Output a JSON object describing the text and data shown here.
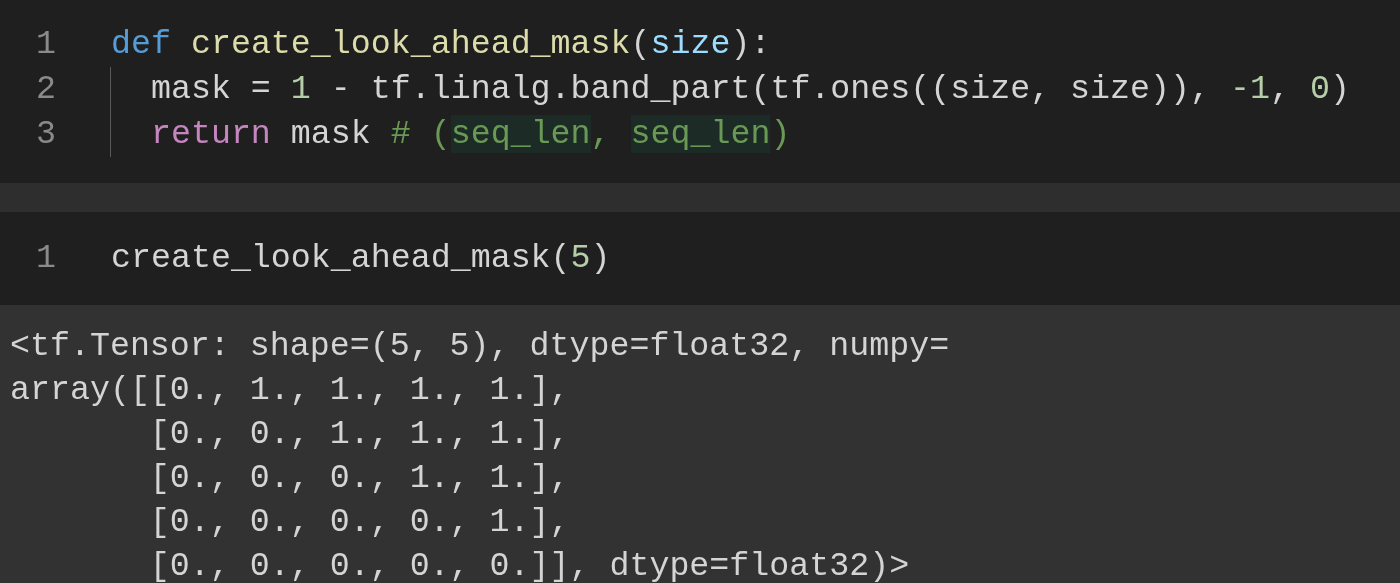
{
  "cells": [
    {
      "kind": "code",
      "lines": [
        {
          "number": "1",
          "indent_guide": false,
          "tokens": [
            {
              "text": "def ",
              "kind": "keyword"
            },
            {
              "text": "create_look_ahead_mask",
              "kind": "function"
            },
            {
              "text": "(",
              "kind": "plain"
            },
            {
              "text": "size",
              "kind": "param"
            },
            {
              "text": "):",
              "kind": "plain"
            }
          ]
        },
        {
          "number": "2",
          "indent_guide": true,
          "tokens": [
            {
              "text": "  mask = ",
              "kind": "plain"
            },
            {
              "text": "1",
              "kind": "number"
            },
            {
              "text": " - tf.linalg.band_part(tf.ones((size, size)), ",
              "kind": "plain"
            },
            {
              "text": "-1",
              "kind": "number"
            },
            {
              "text": ", ",
              "kind": "plain"
            },
            {
              "text": "0",
              "kind": "number"
            },
            {
              "text": ")",
              "kind": "plain"
            }
          ]
        },
        {
          "number": "3",
          "indent_guide": true,
          "tokens": [
            {
              "text": "  return",
              "kind": "control"
            },
            {
              "text": " mask ",
              "kind": "plain"
            },
            {
              "text": "# (",
              "kind": "comment"
            },
            {
              "text": "seq_len",
              "kind": "comment",
              "highlighted": true
            },
            {
              "text": ", ",
              "kind": "comment",
              "highlighted": false
            },
            {
              "text": "seq_len",
              "kind": "comment",
              "highlighted": true
            },
            {
              "text": ")",
              "kind": "comment"
            }
          ]
        }
      ]
    },
    {
      "kind": "code",
      "lines": [
        {
          "number": "1",
          "indent_guide": false,
          "tokens": [
            {
              "text": "create_look_ahead_mask(",
              "kind": "plain"
            },
            {
              "text": "5",
              "kind": "number"
            },
            {
              "text": ")",
              "kind": "plain"
            }
          ]
        }
      ]
    },
    {
      "kind": "output",
      "lines": [
        "<tf.Tensor: shape=(5, 5), dtype=float32, numpy=",
        "array([[0., 1., 1., 1., 1.],",
        "       [0., 0., 1., 1., 1.],",
        "       [0., 0., 0., 1., 1.],",
        "       [0., 0., 0., 0., 1.],",
        "       [0., 0., 0., 0., 0.]], dtype=float32)>"
      ]
    }
  ]
}
